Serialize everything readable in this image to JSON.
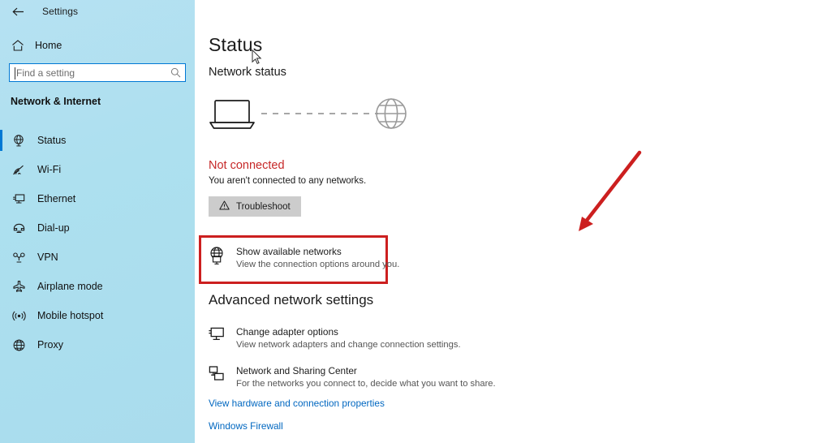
{
  "window": {
    "app_title": "Settings",
    "back_icon": "back-arrow-icon",
    "controls": {
      "minimize": "─",
      "restore": "❐",
      "close": "✕"
    }
  },
  "sidebar": {
    "home": {
      "label": "Home",
      "icon": "home-icon"
    },
    "search": {
      "placeholder": "Find a setting",
      "value": "",
      "icon": "search-icon"
    },
    "section_title": "Network & Internet",
    "accent_color": "#0078d4",
    "background_color": "#ade0ef",
    "items": [
      {
        "label": "Status",
        "icon": "globe-monitor-icon",
        "selected": true
      },
      {
        "label": "Wi-Fi",
        "icon": "wifi-icon",
        "selected": false
      },
      {
        "label": "Ethernet",
        "icon": "ethernet-icon",
        "selected": false
      },
      {
        "label": "Dial-up",
        "icon": "dialup-phone-icon",
        "selected": false
      },
      {
        "label": "VPN",
        "icon": "vpn-icon",
        "selected": false
      },
      {
        "label": "Airplane mode",
        "icon": "airplane-icon",
        "selected": false
      },
      {
        "label": "Mobile hotspot",
        "icon": "hotspot-icon",
        "selected": false
      },
      {
        "label": "Proxy",
        "icon": "globe-icon",
        "selected": false
      }
    ]
  },
  "main": {
    "page_title": "Status",
    "network_status_heading": "Network status",
    "diagram": {
      "device_icon": "laptop-icon",
      "internet_icon": "globe-icon",
      "link_style": "dashed-disconnected"
    },
    "connection": {
      "state": "Not connected",
      "state_color": "#c62828",
      "description": "You aren't connected to any networks."
    },
    "troubleshoot_button": {
      "label": "Troubleshoot",
      "icon": "warning-triangle-icon"
    },
    "show_networks_card": {
      "title": "Show available networks",
      "subtitle": "View the connection options around you.",
      "icon": "globe-monitor-icon",
      "highlighted": true,
      "highlight_color": "#cc1f1f"
    },
    "advanced": {
      "heading": "Advanced network settings",
      "items": [
        {
          "title": "Change adapter options",
          "subtitle": "View network adapters and change connection settings.",
          "icon": "monitor-icon"
        },
        {
          "title": "Network and Sharing Center",
          "subtitle": "For the networks you connect to, decide what you want to share.",
          "icon": "sharing-icon"
        }
      ],
      "links": [
        {
          "label": "View hardware and connection properties",
          "color": "#0067c0"
        },
        {
          "label": "Windows Firewall",
          "color": "#0067c0"
        }
      ]
    },
    "annotation": {
      "type": "red-arrow",
      "points_to": "show_networks_card",
      "color": "#cc1f1f"
    }
  }
}
